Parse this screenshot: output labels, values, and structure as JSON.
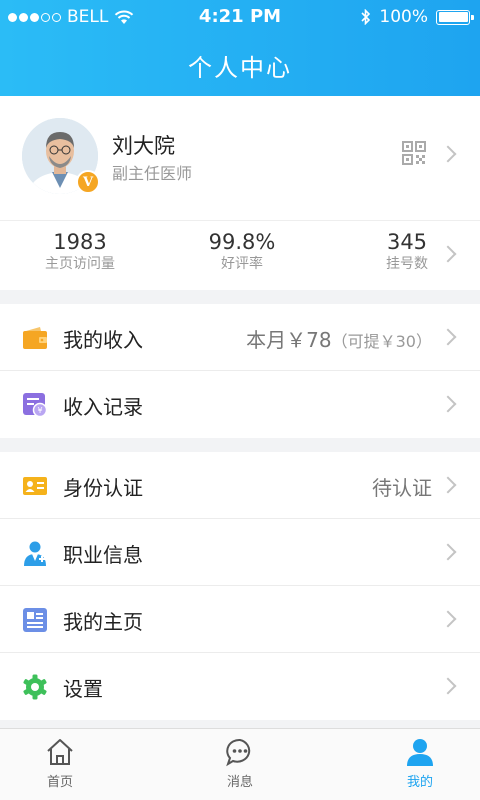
{
  "status_bar": {
    "carrier": "BELL",
    "time": "4:21 PM",
    "battery": "100%",
    "battery_level": 1.0
  },
  "header": {
    "title": "个人中心"
  },
  "profile": {
    "name": "刘大院",
    "title": "副主任医师",
    "badge": "V"
  },
  "stats": [
    {
      "value": "1983",
      "label": "主页访问量"
    },
    {
      "value": "99.8%",
      "label": "好评率"
    },
    {
      "value": "345",
      "label": "挂号数"
    }
  ],
  "income": {
    "my_income_label": "我的收入",
    "month_value": "本月￥78",
    "withdrawable": "（可提￥30）",
    "records_label": "收入记录"
  },
  "menu": {
    "identity_label": "身份认证",
    "identity_status": "待认证",
    "career_label": "职业信息",
    "homepage_label": "我的主页",
    "settings_label": "设置"
  },
  "tabs": [
    {
      "label": "首页",
      "icon": "home-icon"
    },
    {
      "label": "消息",
      "icon": "message-icon"
    },
    {
      "label": "我的",
      "icon": "user-icon"
    }
  ],
  "colors": {
    "accent": "#1ea4f0",
    "wallet": "#f5a623",
    "records": "#8b6fe0",
    "identity": "#f5b21b",
    "career": "#2d9ee8",
    "homepage": "#6c8fe6",
    "settings": "#3ec05a"
  }
}
